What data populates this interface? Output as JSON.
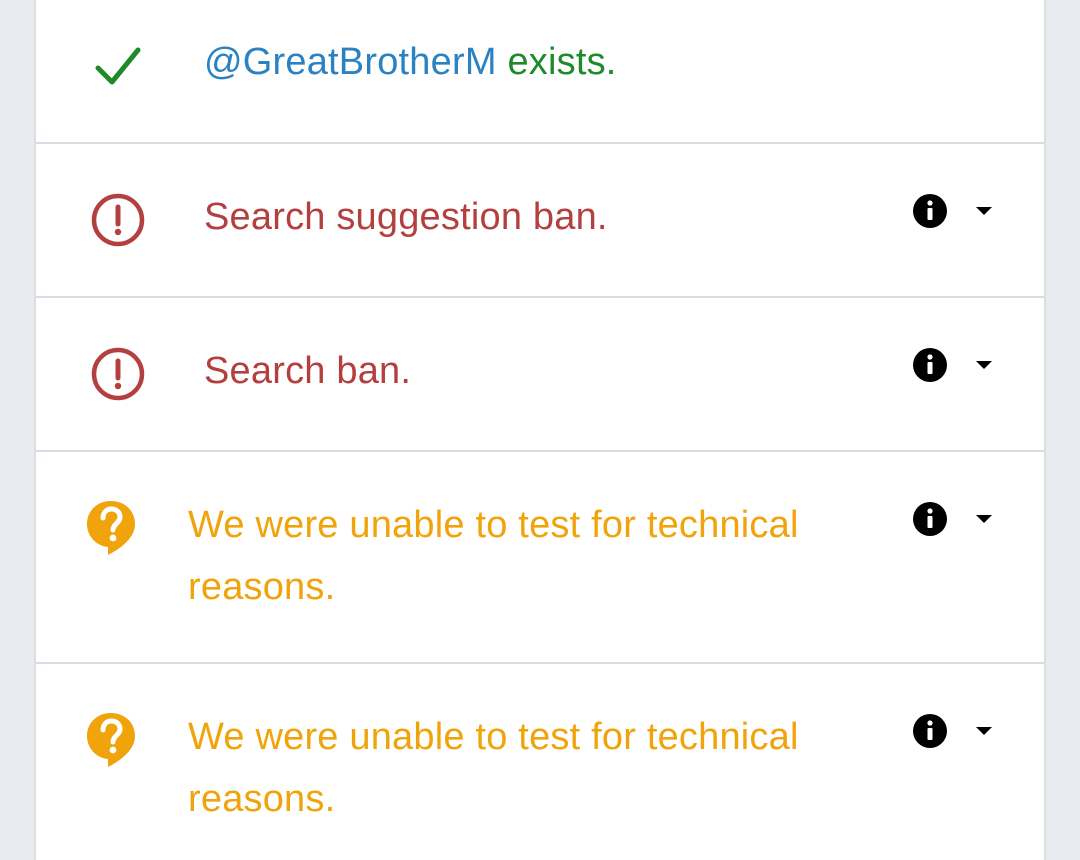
{
  "rows": [
    {
      "status": "exists",
      "icon": "checkmark-icon",
      "handle": "@GreatBrotherM",
      "suffix": " exists.",
      "color_handle": "#2a82c2",
      "color_suffix": "#1f8a2a"
    },
    {
      "status": "ban",
      "icon": "alert-circle-icon",
      "text": "Search suggestion ban.",
      "color": "#b3403f",
      "has_info": true
    },
    {
      "status": "ban",
      "icon": "alert-circle-icon",
      "text": "Search ban.",
      "color": "#b3403f",
      "has_info": true
    },
    {
      "status": "unknown",
      "icon": "question-bubble-icon",
      "line1": "We were unable to test for technical",
      "line2": "reasons.",
      "color": "#f0a30a",
      "has_info": true
    },
    {
      "status": "unknown",
      "icon": "question-bubble-icon",
      "line1": "We were unable to test for technical",
      "line2": "reasons.",
      "color": "#f0a30a",
      "has_info": true
    }
  ],
  "icons": {
    "info": "info-icon",
    "dropdown": "caret-down-icon"
  }
}
